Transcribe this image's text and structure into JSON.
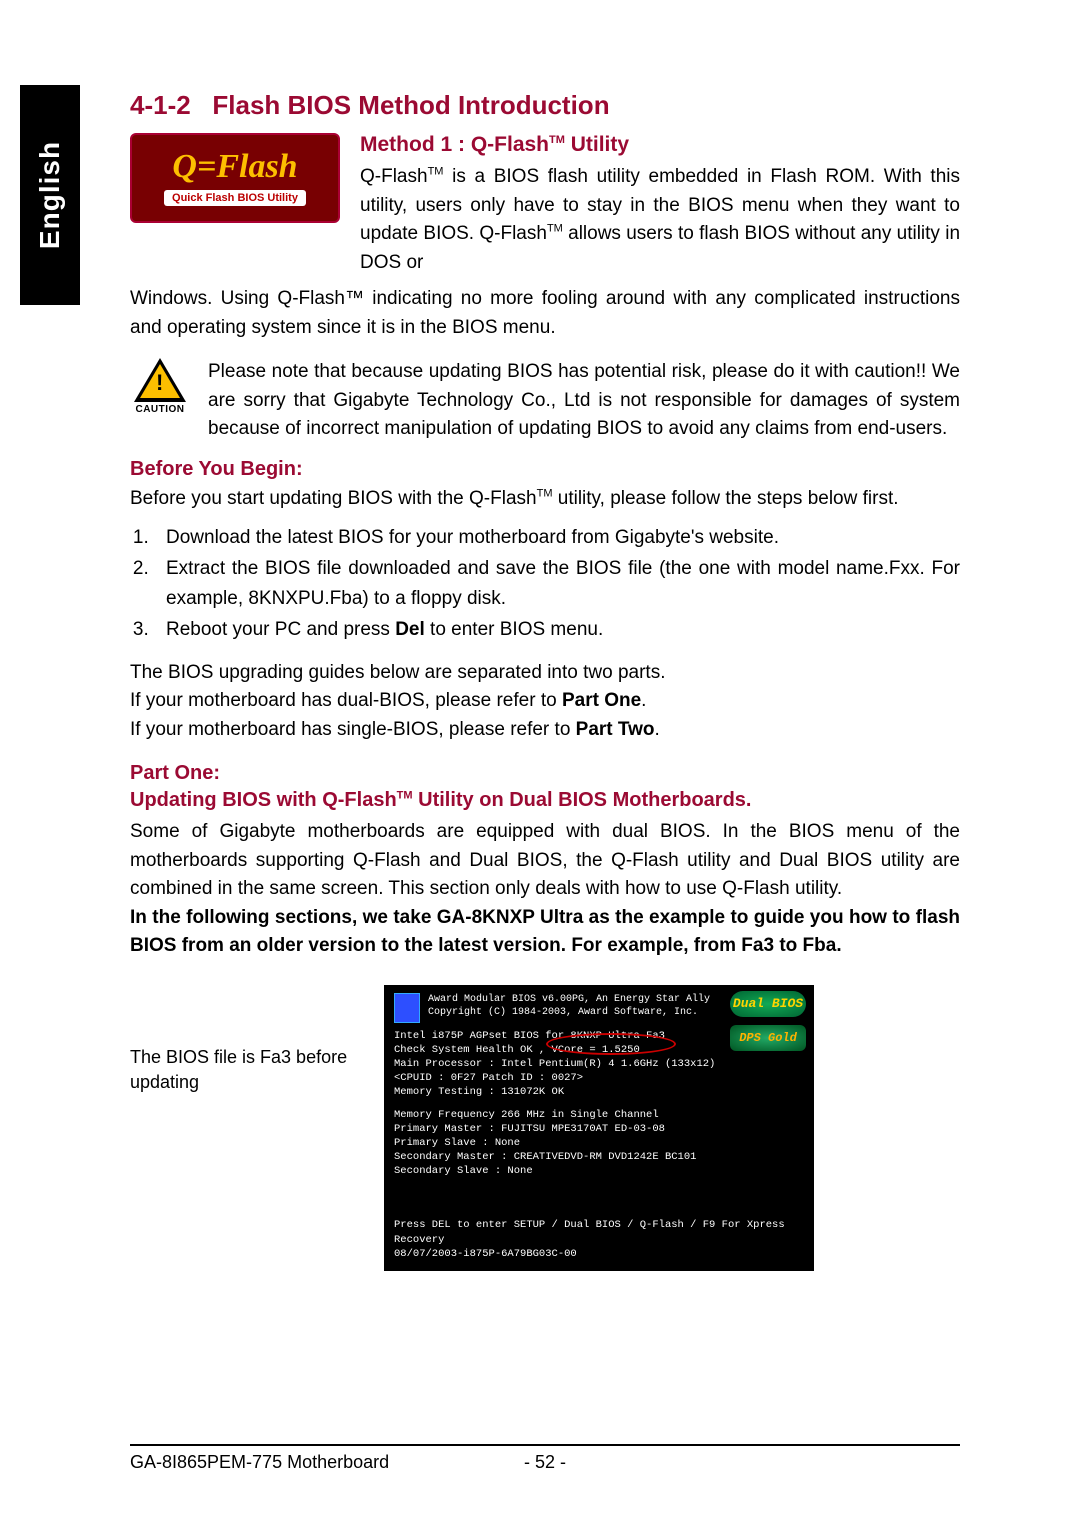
{
  "side_tab": "English",
  "section_number": "4-1-2",
  "section_title": "Flash BIOS Method Introduction",
  "qflash_logo": {
    "main": "Q=Flash",
    "sub": "Quick Flash BIOS Utility"
  },
  "method1": {
    "title_prefix": "Method 1 : Q-Flash",
    "title_tm": "TM",
    "title_suffix": " Utility",
    "para1a": "Q-Flash",
    "para1b": " is a BIOS flash utility embedded in Flash ROM. With this utility, users only have to stay in the BIOS menu when they want to update BIOS. Q-Flash",
    "para1c": " allows users to flash BIOS without any utility in DOS or",
    "para2": "Windows. Using Q-Flash™ indicating no more fooling around with any complicated instructions and operating system since it is in the BIOS menu."
  },
  "caution": {
    "label": "CAUTION",
    "text": "Please note that because updating BIOS has potential risk, please do it with caution!! We are sorry that Gigabyte Technology Co., Ltd is not responsible for damages of system because of incorrect manipulation of updating BIOS to avoid any claims from end-users."
  },
  "before_begin": {
    "heading": "Before You Begin:",
    "intro_a": "Before you start updating BIOS with the Q-Flash",
    "intro_b": " utility, please follow the steps below first.",
    "steps": [
      "Download the latest BIOS for your motherboard from Gigabyte's website.",
      "Extract the BIOS file downloaded and save the BIOS file (the one with model name.Fxx. For example, 8KNXPU.Fba) to a floppy disk.",
      "Reboot your PC and press Del to enter BIOS menu."
    ],
    "post1": "The BIOS upgrading guides below are separated into two parts.",
    "post2a": "If your motherboard has dual-BIOS, please refer to ",
    "post2b": "Part One",
    "post3a": "If your motherboard has single-BIOS, please refer to ",
    "post3b": "Part Two"
  },
  "part_one": {
    "heading": "Part One:",
    "subheading_a": "Updating BIOS with Q-Flash",
    "subheading_b": " Utility on Dual BIOS Motherboards.",
    "para": "Some of Gigabyte motherboards are equipped with dual BIOS. In the BIOS menu of the motherboards supporting Q-Flash and Dual BIOS, the Q-Flash utility and Dual BIOS utility are combined in the same screen. This section only deals with how to use Q-Flash utility.",
    "bold_note": "In the following sections, we take GA-8KNXP Ultra as the example to guide you how to flash BIOS from an older version to the latest version. For example, from Fa3 to Fba."
  },
  "bios_caption": "The BIOS file is Fa3 before updating",
  "bios_screen": {
    "header1": "Award Modular BIOS v6.00PG, An Energy Star Ally",
    "header2": "Copyright  (C) 1984-2003, Award Software,  Inc.",
    "dual_badge": "Dual BIOS",
    "dps_badge": "DPS Gold",
    "l1": "Intel i875P AGPset BIOS for 8KNXP Ultra Fa3",
    "l2": "Check System Health OK , VCore = 1.5250",
    "l3": "Main Processor : Intel Pentium(R) 4  1.6GHz (133x12)",
    "l4": "<CPUID : 0F27 Patch ID  : 0027>",
    "l5": "Memory Testing  : 131072K OK",
    "l6": "Memory Frequency 266 MHz in Single Channel",
    "l7": "Primary Master : FUJITSU MPE3170AT ED-03-08",
    "l8": "Primary Slave : None",
    "l9": "Secondary Master :  CREATIVEDVD-RM DVD1242E BC101",
    "l10": "Secondary Slave : None",
    "f1": "Press DEL to enter SETUP / Dual BIOS / Q-Flash / F9 For Xpress Recovery",
    "f2": "08/07/2003-i875P-6A79BG03C-00"
  },
  "footer": {
    "model": "GA-8I865PEM-775 Motherboard",
    "page": "- 52 -"
  }
}
